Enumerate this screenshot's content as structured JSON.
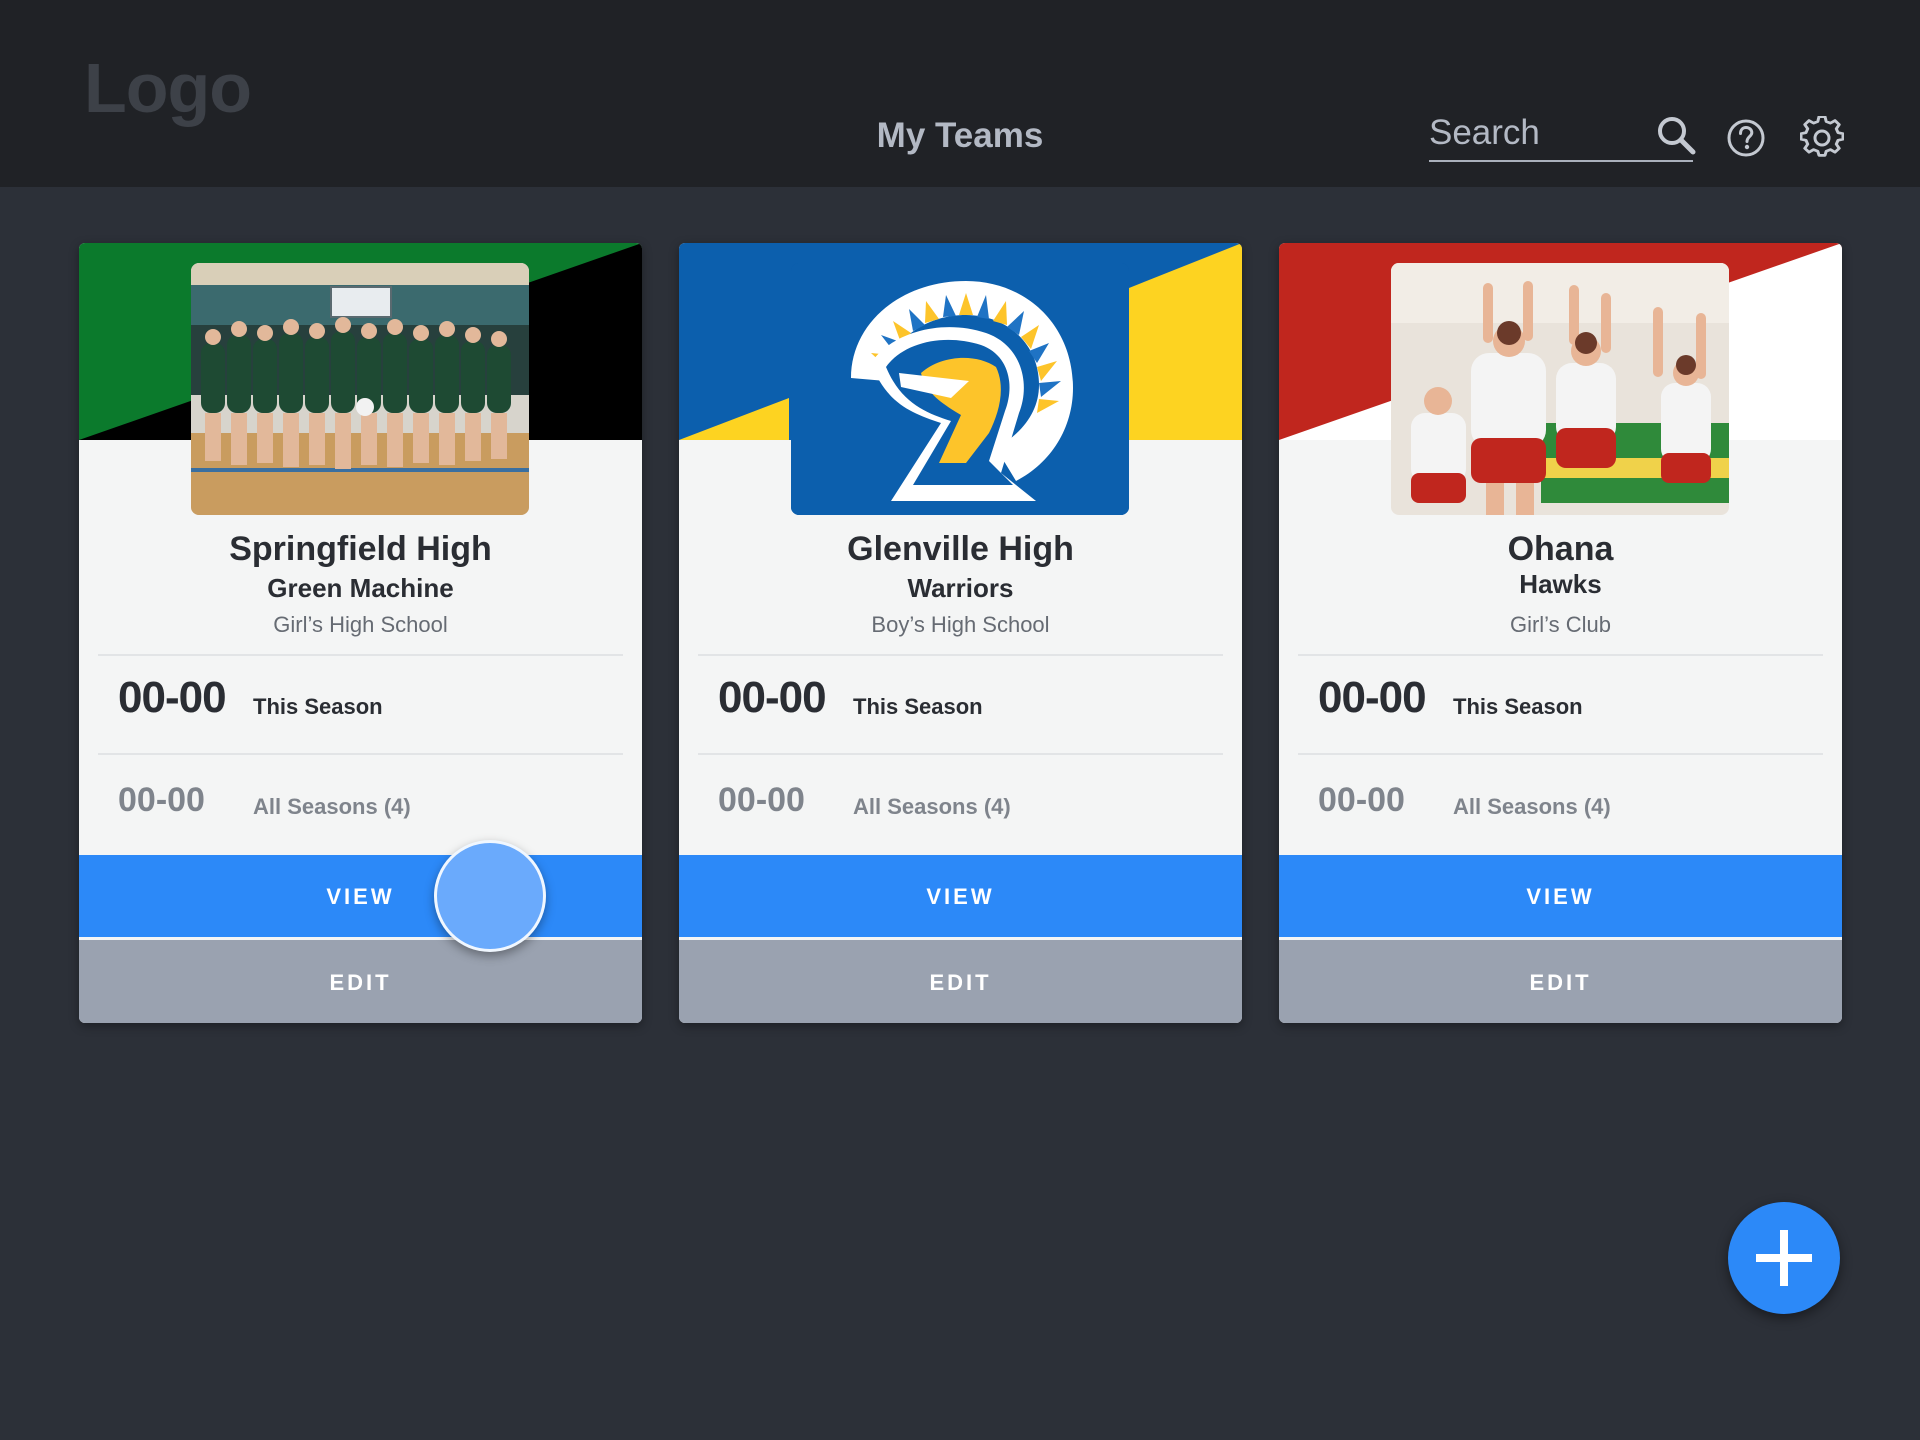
{
  "header": {
    "logo_text": "Logo",
    "title": "My Teams",
    "search": {
      "placeholder": "Search",
      "value": ""
    },
    "icons": [
      "search-icon",
      "help-icon",
      "gear-icon"
    ]
  },
  "teams": [
    {
      "school": "Springfield High",
      "name": "Green Machine",
      "type": "Girl’s High School",
      "season_record": "00-00",
      "season_label": "This Season",
      "all_record": "00-00",
      "all_label": "All Seasons (4)",
      "view_label": "VIEW",
      "edit_label": "EDIT",
      "colors": [
        "#0b7a2c",
        "#000000"
      ]
    },
    {
      "school": "Glenville High",
      "name": "Warriors",
      "type": "Boy’s High School",
      "season_record": "00-00",
      "season_label": "This Season",
      "all_record": "00-00",
      "all_label": "All Seasons (4)",
      "view_label": "VIEW",
      "edit_label": "EDIT",
      "colors": [
        "#0c5fad",
        "#fdd321"
      ]
    },
    {
      "school": "Ohana",
      "name": "Hawks",
      "type": "Girl’s Club",
      "season_record": "00-00",
      "season_label": "This Season",
      "all_record": "00-00",
      "all_label": "All Seasons (4)",
      "view_label": "VIEW",
      "edit_label": "EDIT",
      "colors": [
        "#c0261e",
        "#ffffff"
      ]
    }
  ],
  "fab": {
    "icon": "plus-icon"
  },
  "theme": {
    "accent": "#2c89f8",
    "edit_gray": "#9aa2b0",
    "background": "#2c3038",
    "header_bg": "#202226"
  }
}
